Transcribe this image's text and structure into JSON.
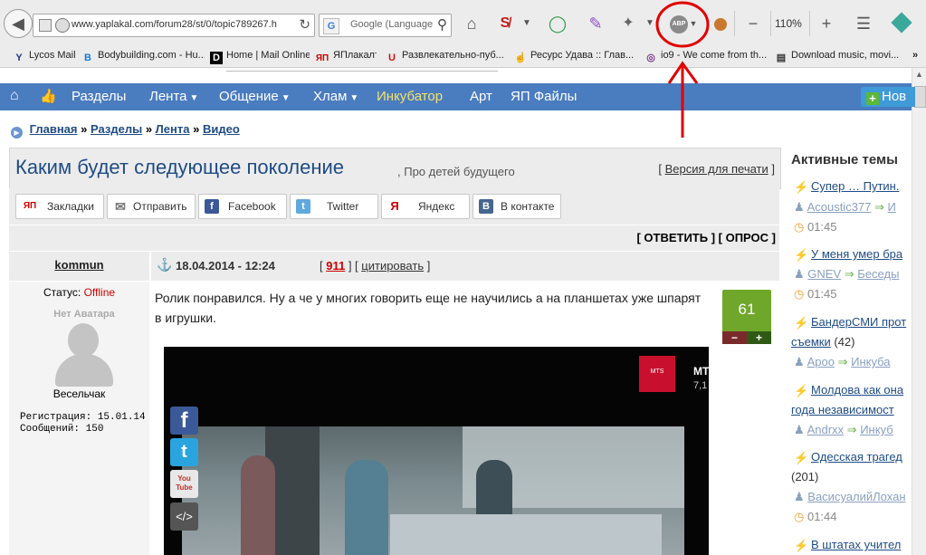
{
  "browser": {
    "url": "www.yaplakal.com/forum28/st/0/topic789267.h",
    "search_placeholder": "Google (Language",
    "zoom": "110%",
    "adblock_label": "ABP",
    "menu_minus": "−",
    "menu_plus": "+"
  },
  "bookmarks": [
    {
      "label": "Lycos Mail",
      "icon": "Y"
    },
    {
      "label": "Bodybuilding.com - Hu...",
      "icon": "B"
    },
    {
      "label": "Home | Mail Online",
      "icon": "D"
    },
    {
      "label": "ЯПлакалъ",
      "icon": "ЯП"
    },
    {
      "label": "Развлекательно-пуб...",
      "icon": "U"
    },
    {
      "label": "Ресурс Удава :: Глав...",
      "icon": "☝"
    },
    {
      "label": "io9 - We come from th...",
      "icon": "◎"
    },
    {
      "label": "Download music, movi...",
      "icon": "▤"
    }
  ],
  "bookmarks_more": "»",
  "nav": {
    "items": [
      "Разделы",
      "Лента",
      "Общение",
      "Хлам",
      "Инкубатор",
      "Арт",
      "ЯП Файлы"
    ],
    "new_button": "Нов"
  },
  "breadcrumb": {
    "items": [
      "Главная",
      "Разделы",
      "Лента",
      "Видео"
    ],
    "separator": "»"
  },
  "topic": {
    "title": "Каким будет следующее поколение",
    "subtitle": ", Про детей будущего",
    "print_version": "Версия для печати",
    "bracket_open": "[",
    "bracket_close": "]"
  },
  "share": [
    {
      "label": "Закладки",
      "icon": "ЯП",
      "color": "#ffffff",
      "text_color": "#cc0000"
    },
    {
      "label": "Отправить",
      "icon": "✉",
      "color": "#ffffff",
      "text_color": "#777777"
    },
    {
      "label": "Facebook",
      "icon": "f",
      "color": "#3b5998",
      "text_color": "#ffffff"
    },
    {
      "label": "Twitter",
      "icon": "t",
      "color": "#5ea9dd",
      "text_color": "#ffffff"
    },
    {
      "label": "Яндекс",
      "icon": "Я",
      "color": "#ffffff",
      "text_color": "#cc0000"
    },
    {
      "label": "В контакте",
      "icon": "B",
      "color": "#45668e",
      "text_color": "#ffffff"
    }
  ],
  "reply_links": {
    "reply": "ОТВЕТИТЬ",
    "poll": "ОПРОС"
  },
  "post": {
    "author": "kommun",
    "status_label": "Статус:",
    "status": "Offline",
    "avatar_text": "Нет Аватара",
    "rank": "Весельчак",
    "reg_label": "Регистрация:",
    "reg_date": "15.01.14",
    "posts_label": "Сообщений:",
    "posts_count": "150",
    "date": "18.04.2014 - 12:24",
    "post_number": "911",
    "quote": "цитировать",
    "text": "Ролик понравился. Ну а че у многих говорить еще не научились а на планшетах уже шпарят в игрушки.",
    "rating": "61",
    "rating_minus": "−",
    "rating_plus": "+"
  },
  "video": {
    "brand": "МТS",
    "title_fragment": "МТ",
    "sub_fragment": "7,1",
    "social": [
      "facebook",
      "twitter",
      "youtube",
      "embed"
    ],
    "social_labels": [
      "f",
      "t",
      "You Tube",
      "</>"
    ]
  },
  "sidebar": {
    "title": "Активные темы",
    "topics": [
      {
        "title": "Супер … Путин.",
        "user": "Acoustic377",
        "arrow": "⇒",
        "section": "И",
        "time": "01:45"
      },
      {
        "title": "У меня умер бра",
        "user": "GNEV",
        "arrow": "⇒",
        "section": "Беседы",
        "time": "01:45"
      },
      {
        "title": "БандерСМИ прот",
        "title2": "съемки",
        "count": "(42)",
        "user": "Apoo",
        "arrow": "⇒",
        "section": "Инкуба",
        "time": ""
      },
      {
        "title": "Молдова как она",
        "title2": "года независимост",
        "user": "Andrxx",
        "arrow": "⇒",
        "section": "Инкуб",
        "time": "01:45"
      },
      {
        "title": "Одесская трагед",
        "count": "(201)",
        "user": "ВасисуалийЛохан",
        "arrow": "",
        "section": "",
        "time": "01:44"
      },
      {
        "title": "В штатах учител",
        "user": "",
        "arrow": "",
        "section": "",
        "time": ""
      }
    ]
  },
  "annotation": {
    "color": "#e00000"
  },
  "colors": {
    "nav_bg": "#4a7cc0",
    "incubator": "#f3e36b",
    "link": "#1f4c85",
    "offline": "#cc0000",
    "rating_green": "#6fa72a"
  }
}
